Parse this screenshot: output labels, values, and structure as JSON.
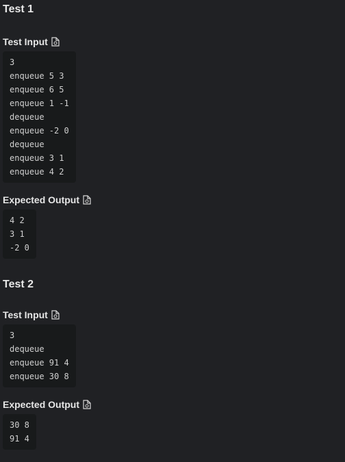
{
  "tests": [
    {
      "title": "Test 1",
      "input_label": "Test Input",
      "input_lines": [
        "3",
        "enqueue 5 3",
        "enqueue 6 5",
        "enqueue 1 -1",
        "dequeue",
        "enqueue -2 0",
        "dequeue",
        "enqueue 3 1",
        "enqueue 4 2"
      ],
      "output_label": "Expected Output",
      "output_lines": [
        "4 2",
        "3 1",
        "-2 0"
      ]
    },
    {
      "title": "Test 2",
      "input_label": "Test Input",
      "input_lines": [
        "3",
        "dequeue",
        "enqueue 91 4",
        "enqueue 30 8"
      ],
      "output_label": "Expected Output",
      "output_lines": [
        "30 8",
        "91 4"
      ]
    }
  ],
  "icons": {
    "copy": "copy-file-icon"
  },
  "colors": {
    "background": "#202124",
    "code_background": "#181a1b",
    "text": "#e6e6e6"
  }
}
